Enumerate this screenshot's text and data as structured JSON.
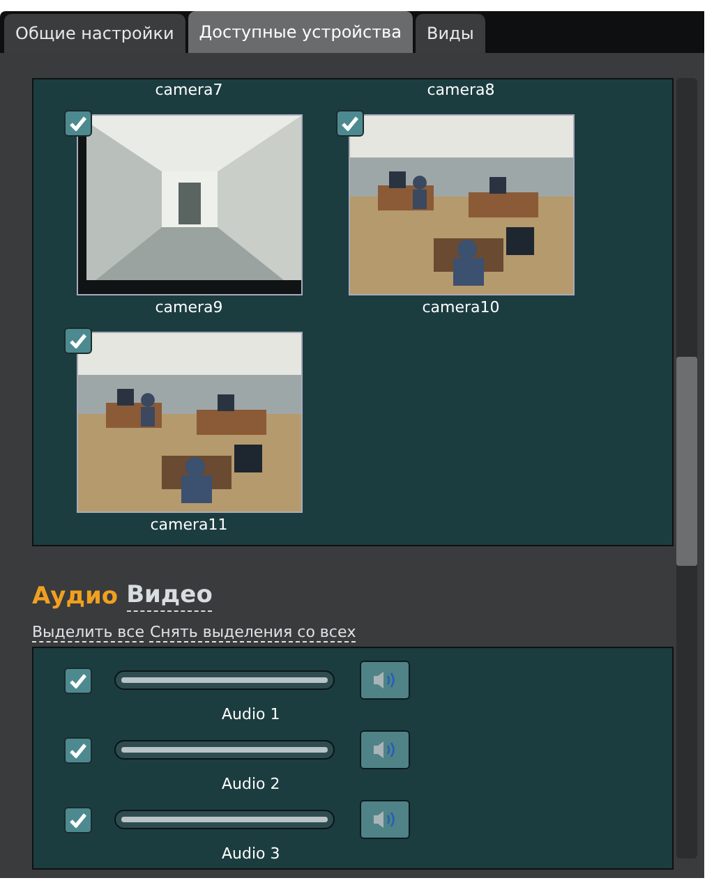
{
  "tabs": [
    {
      "label": "Общие настройки",
      "selected": false
    },
    {
      "label": "Доступные устройства",
      "selected": true
    },
    {
      "label": "Виды",
      "selected": false
    }
  ],
  "camera_labels_top": [
    "camera7",
    "camera8"
  ],
  "cameras": [
    {
      "name": "camera9",
      "checked": true,
      "kind": "corridor"
    },
    {
      "name": "camera10",
      "checked": true,
      "kind": "office"
    },
    {
      "name": "camera11",
      "checked": true,
      "kind": "office"
    }
  ],
  "media_tabs": [
    {
      "label": "Аудио",
      "selected": true
    },
    {
      "label": "Видео",
      "selected": false
    }
  ],
  "links": [
    "Выделить все",
    "Снять выделения со всех"
  ],
  "audio": [
    {
      "name": "Audio 1",
      "checked": true,
      "level": 1
    },
    {
      "name": "Audio 2",
      "checked": true,
      "level": 1
    },
    {
      "name": "Audio 3",
      "checked": true,
      "level": 1
    }
  ]
}
